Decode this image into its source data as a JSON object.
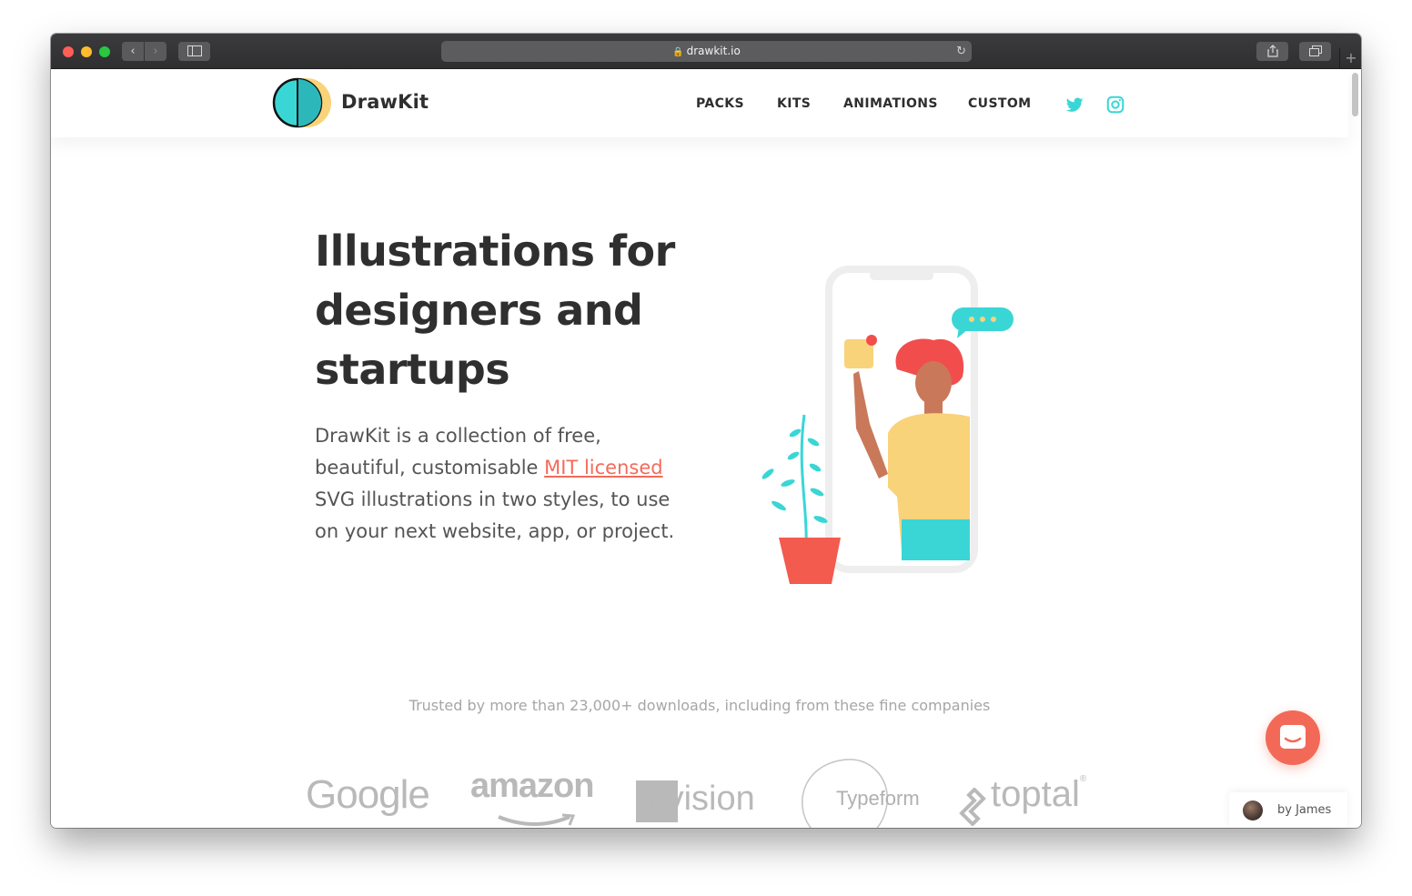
{
  "browser": {
    "url": "drawkit.io",
    "back_icon": "chevron-left-icon",
    "forward_icon": "chevron-right-icon",
    "sidebar_icon": "sidebar-icon",
    "share_icon": "share-icon",
    "tabs_icon": "tabs-icon",
    "new_tab": "+"
  },
  "header": {
    "brand": "DrawKit",
    "nav": [
      "PACKS",
      "KITS",
      "ANIMATIONS",
      "CUSTOM"
    ],
    "social": [
      "twitter-icon",
      "instagram-icon"
    ]
  },
  "hero": {
    "title": "Illustrations for designers and startups",
    "desc_before": "DrawKit is a collection of free, beautiful, customisable ",
    "desc_link": "MIT licensed",
    "desc_after": " SVG illustrations in two styles, to use on your next website, app, or project."
  },
  "trusted": {
    "text": "Trusted by more than 23,000+ downloads, including from these fine companies",
    "companies": [
      "Google",
      "amazon",
      "invision",
      "Typeform",
      "toptal"
    ]
  },
  "widget": {
    "by": "by James"
  },
  "colors": {
    "accent": "#f36b5b",
    "teal": "#3ad6d6",
    "yellow": "#f9d37a"
  }
}
